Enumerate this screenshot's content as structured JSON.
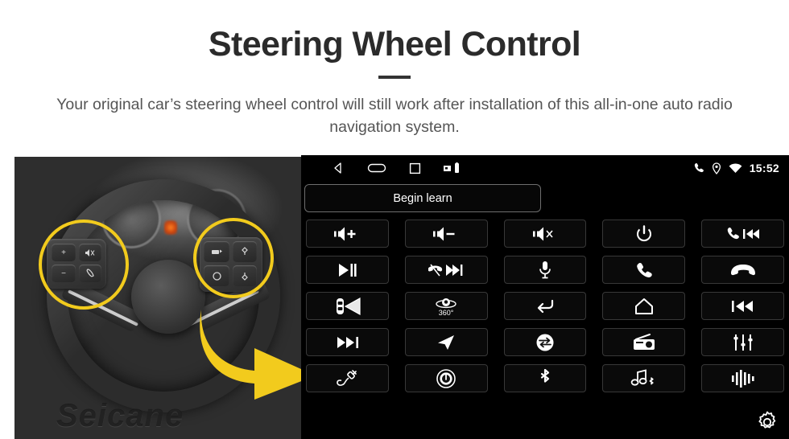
{
  "header": {
    "title": "Steering Wheel Control",
    "subtitle": "Your original car’s steering wheel control will still work after installation of this all-in-one auto radio navigation system."
  },
  "photo": {
    "watermark": "Seicane",
    "highlight_color": "#f2cb1d",
    "arrow_color": "#f2cb1d",
    "left_cluster_keys": [
      "+",
      "−",
      "mute-icon",
      "phone-icon"
    ],
    "right_cluster_keys": [
      "media-icon",
      "up-icon",
      "circle-icon",
      "down-icon"
    ]
  },
  "head_unit": {
    "background": "#000000",
    "status_bar": {
      "nav_icons": [
        "back-icon",
        "home-icon",
        "recents-icon"
      ],
      "system_icons": [
        "sdcard-icon",
        "usb-icon"
      ],
      "tray_icons": [
        "phone-icon",
        "location-icon",
        "wifi-icon"
      ],
      "time": "15:52"
    },
    "begin_learn_label": "Begin learn",
    "settings_icon": "gear-icon",
    "buttons": [
      {
        "name": "volume-up",
        "icon": "volume-up-icon",
        "label": "Volume +"
      },
      {
        "name": "volume-down",
        "icon": "volume-down-icon",
        "label": "Volume −"
      },
      {
        "name": "mute",
        "icon": "volume-mute-icon",
        "label": "Mute"
      },
      {
        "name": "power",
        "icon": "power-icon",
        "label": "Power"
      },
      {
        "name": "call-previous",
        "icon": "phone-previous-icon",
        "label": "Call / Previous"
      },
      {
        "name": "play-pause",
        "icon": "play-pause-icon",
        "label": "Play / Pause"
      },
      {
        "name": "hangup-next",
        "icon": "hangup-next-icon",
        "label": "Hang up / Next"
      },
      {
        "name": "voice-command",
        "icon": "microphone-icon",
        "label": "Voice command"
      },
      {
        "name": "answer-call",
        "icon": "phone-answer-icon",
        "label": "Answer call"
      },
      {
        "name": "end-call",
        "icon": "phone-hangup-icon",
        "label": "End call"
      },
      {
        "name": "blind-spot",
        "icon": "car-radar-icon",
        "label": "Blind spot"
      },
      {
        "name": "camera-360",
        "icon": "camera-360-icon",
        "label": "360°",
        "caption": "360°"
      },
      {
        "name": "back",
        "icon": "back-arrow-icon",
        "label": "Back"
      },
      {
        "name": "home",
        "icon": "home-icon",
        "label": "Home"
      },
      {
        "name": "previous-track",
        "icon": "previous-track-icon",
        "label": "Previous track"
      },
      {
        "name": "next-track",
        "icon": "next-track-icon",
        "label": "Next track"
      },
      {
        "name": "navigation",
        "icon": "navigation-arrow-icon",
        "label": "Navigation"
      },
      {
        "name": "source-switch",
        "icon": "swap-mode-icon",
        "label": "Source switch"
      },
      {
        "name": "radio",
        "icon": "radio-icon",
        "label": "Radio"
      },
      {
        "name": "equalizer",
        "icon": "equalizer-icon",
        "label": "Equalizer"
      },
      {
        "name": "aux-cable",
        "icon": "cable-plug-icon",
        "label": "AUX"
      },
      {
        "name": "disc",
        "icon": "disc-icon",
        "label": "Disc"
      },
      {
        "name": "bluetooth",
        "icon": "bluetooth-icon",
        "label": "Bluetooth"
      },
      {
        "name": "bt-music",
        "icon": "bluetooth-music-icon",
        "label": "Bluetooth music"
      },
      {
        "name": "audio-wave",
        "icon": "audio-wave-icon",
        "label": "Audio"
      }
    ]
  }
}
